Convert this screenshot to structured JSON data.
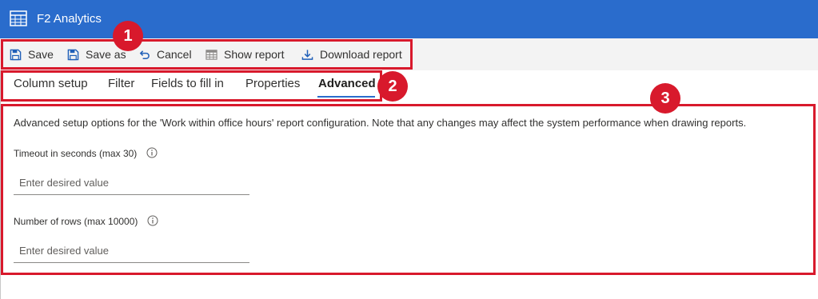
{
  "app": {
    "title": "F2 Analytics"
  },
  "toolbar": {
    "save": "Save",
    "save_as": "Save as",
    "cancel": "Cancel",
    "show_report": "Show report",
    "download_report": "Download report"
  },
  "tabs": [
    {
      "label": "Column setup"
    },
    {
      "label": "Filter"
    },
    {
      "label": "Fields to fill in"
    },
    {
      "label": "Properties"
    },
    {
      "label": "Advanced",
      "active": true
    }
  ],
  "content": {
    "description": "Advanced setup options for the 'Work within office hours' report configuration. Note that any changes may affect the system performance when drawing reports.",
    "fields": [
      {
        "label": "Timeout in seconds (max 30)",
        "placeholder": "Enter desired value",
        "value": ""
      },
      {
        "label": "Number of rows (max 10000)",
        "placeholder": "Enter desired value",
        "value": ""
      }
    ]
  },
  "annotations": [
    {
      "number": "1"
    },
    {
      "number": "2"
    },
    {
      "number": "3"
    }
  ],
  "colors": {
    "titlebar": "#2a6ccc",
    "toolbar_bg": "#f3f3f3",
    "accent": "#2a6ccc",
    "annotation_red": "#d8192c"
  },
  "icons": {
    "app": "report-grid-icon",
    "save": "floppy-disk-icon",
    "save_as": "floppy-disk-icon",
    "cancel": "undo-arrow-icon",
    "show_report": "table-calendar-icon",
    "download_report": "download-icon",
    "info": "info-circle-icon"
  }
}
